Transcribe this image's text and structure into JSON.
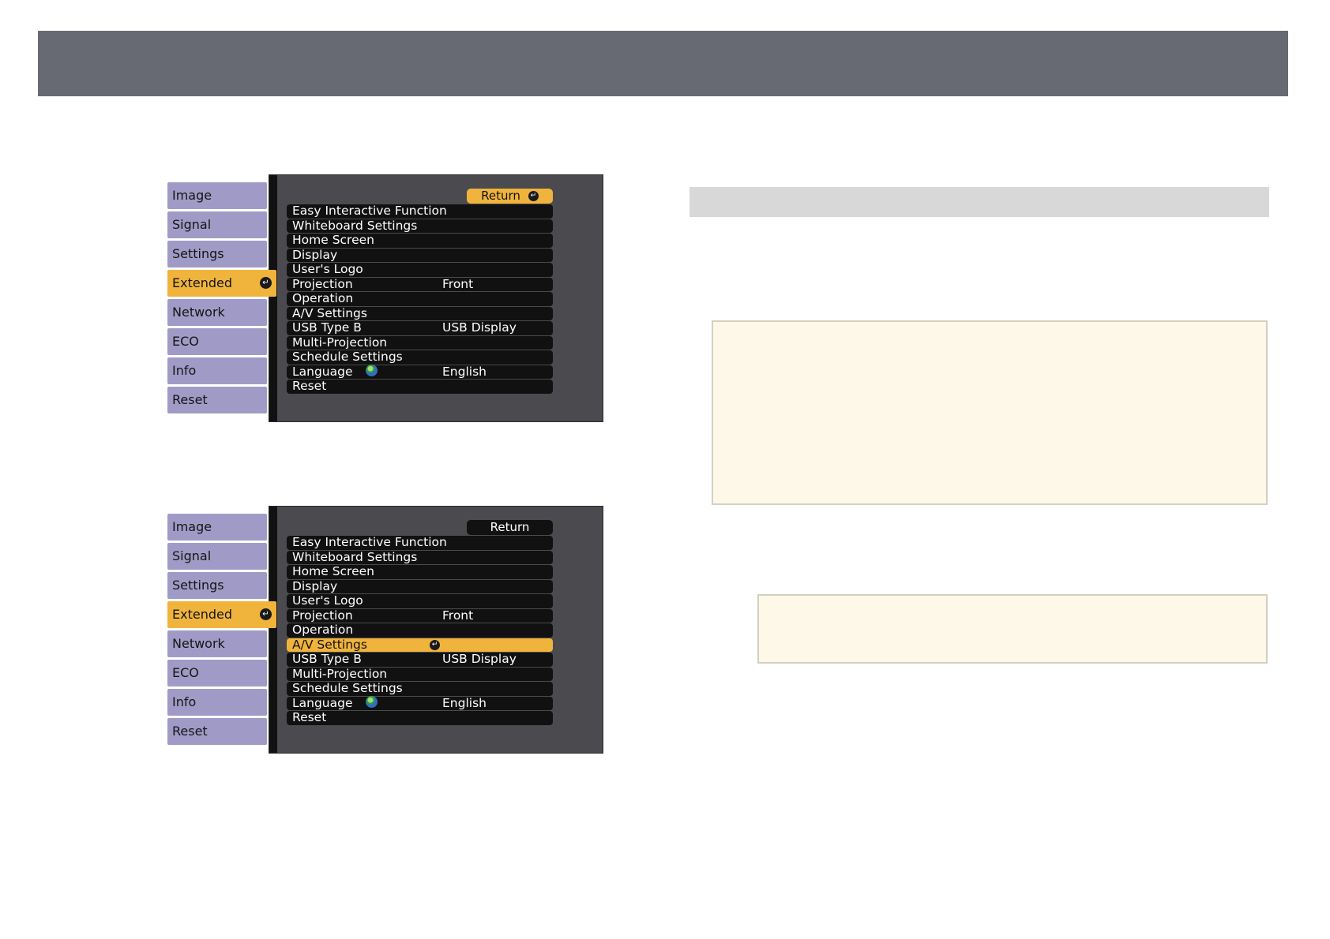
{
  "menu_tabs": {
    "image": "Image",
    "signal": "Signal",
    "settings": "Settings",
    "extended": "Extended",
    "network": "Network",
    "eco": "ECO",
    "info": "Info",
    "reset": "Reset"
  },
  "screen1": {
    "return_label": "Return",
    "return_highlighted": true,
    "items": [
      {
        "label": "Easy Interactive Function",
        "value": ""
      },
      {
        "label": "Whiteboard Settings",
        "value": ""
      },
      {
        "label": "Home Screen",
        "value": ""
      },
      {
        "label": "Display",
        "value": ""
      },
      {
        "label": "User's Logo",
        "value": ""
      },
      {
        "label": "Projection",
        "value": "Front"
      },
      {
        "label": "Operation",
        "value": ""
      },
      {
        "label": "A/V Settings",
        "value": ""
      },
      {
        "label": "USB Type B",
        "value": "USB Display"
      },
      {
        "label": "Multi-Projection",
        "value": ""
      },
      {
        "label": "Schedule Settings",
        "value": ""
      },
      {
        "label": "Language",
        "value": "English"
      },
      {
        "label": "Reset",
        "value": ""
      }
    ]
  },
  "screen2": {
    "return_label": "Return",
    "return_highlighted": false,
    "highlighted_item": "A/V Settings",
    "items": [
      {
        "label": "Easy Interactive Function",
        "value": ""
      },
      {
        "label": "Whiteboard Settings",
        "value": ""
      },
      {
        "label": "Home Screen",
        "value": ""
      },
      {
        "label": "Display",
        "value": ""
      },
      {
        "label": "User's Logo",
        "value": ""
      },
      {
        "label": "Projection",
        "value": "Front"
      },
      {
        "label": "Operation",
        "value": ""
      },
      {
        "label": "A/V Settings",
        "value": ""
      },
      {
        "label": "USB Type B",
        "value": "USB Display"
      },
      {
        "label": "Multi-Projection",
        "value": ""
      },
      {
        "label": "Schedule Settings",
        "value": ""
      },
      {
        "label": "Language",
        "value": "English"
      },
      {
        "label": "Reset",
        "value": ""
      }
    ]
  },
  "colors": {
    "header_bar": "#676a73",
    "tab": "#a09bc6",
    "highlight": "#f0b43c",
    "panel": "#4a4a4f",
    "note_box": "#fdf8e7",
    "gray_bar": "#d8d8d8"
  },
  "icons": {
    "enter": "enter-icon",
    "language": "globe-icon"
  }
}
